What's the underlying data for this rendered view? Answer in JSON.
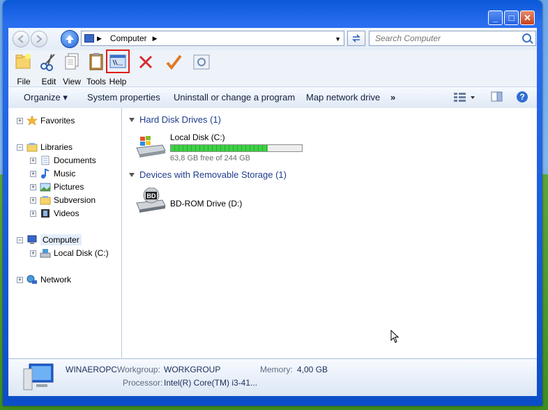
{
  "window": {
    "buttons": {
      "minimize": "_",
      "maximize": "□",
      "close": "✕"
    }
  },
  "nav": {
    "back_icon": "back-arrow-icon",
    "forward_icon": "forward-arrow-icon",
    "up_icon": "up-arrow-icon",
    "address": "Computer",
    "search_placeholder": "Search Computer"
  },
  "toolbar": {
    "items": [
      {
        "label": "File",
        "icon": "new-folder-icon"
      },
      {
        "label": "Edit",
        "icon": "scissors-icon"
      },
      {
        "label": "View",
        "icon": "document-icon"
      },
      {
        "label": "Tools",
        "icon": "clipboard-icon"
      },
      {
        "label": "Help",
        "icon": "command-prompt-icon"
      }
    ]
  },
  "cmdbar": {
    "organize": "Organize",
    "system_properties": "System properties",
    "uninstall": "Uninstall or change a program",
    "map_drive": "Map network drive",
    "more": "»"
  },
  "tree": {
    "favorites": "Favorites",
    "libraries": "Libraries",
    "documents": "Documents",
    "music": "Music",
    "pictures": "Pictures",
    "subversion": "Subversion",
    "videos": "Videos",
    "computer": "Computer",
    "local_disk": "Local Disk (C:)",
    "network": "Network"
  },
  "content": {
    "group_hdd": "Hard Disk Drives (1)",
    "group_removable": "Devices with Removable Storage (1)",
    "drive_c": {
      "name": "Local Disk (C:)",
      "free": "63,8 GB free of 244 GB",
      "used_fraction": 0.74
    },
    "drive_d": {
      "name": "BD-ROM Drive (D:)",
      "badge": "BD"
    }
  },
  "details": {
    "name": "WINAEROPC",
    "workgroup_label": "Workgroup:",
    "workgroup": "WORKGROUP",
    "memory_label": "Memory:",
    "memory": "4,00 GB",
    "processor_label": "Processor:",
    "processor": "Intel(R) Core(TM) i3-41..."
  },
  "colors": {
    "accent": "#0b4ec8",
    "disk_fill": "#2fbd38",
    "highlight": "#e01a1a"
  }
}
